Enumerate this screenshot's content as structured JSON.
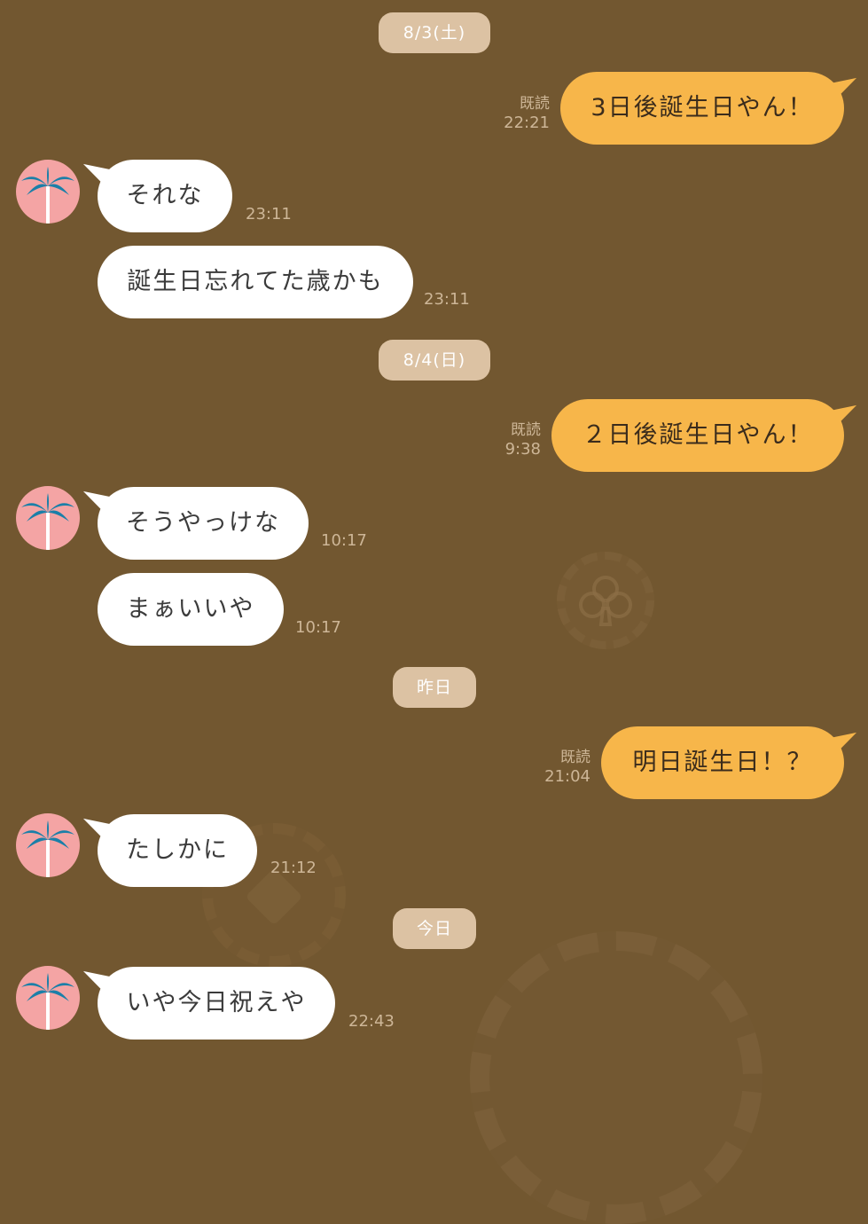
{
  "colors": {
    "background": "#725730",
    "date_pill": "#dcc2a3",
    "outgoing_bubble": "#f7b64a",
    "incoming_bubble": "#ffffff",
    "avatar_bg": "#f4a4a4",
    "palm": "#1b7fa8"
  },
  "avatar_icon": "palm-tree-icon",
  "read_label": "既読",
  "dates": {
    "d1": "8/3(土)",
    "d2": "8/4(日)",
    "d3": "昨日",
    "d4": "今日"
  },
  "messages": {
    "m1": {
      "text": "3日後誕生日やん！",
      "time": "22:21"
    },
    "m2": {
      "text": "それな",
      "time": "23:11"
    },
    "m3": {
      "text": "誕生日忘れてた歳かも",
      "time": "23:11"
    },
    "m4": {
      "text": "２日後誕生日やん！",
      "time": "9:38"
    },
    "m5": {
      "text": "そうやっけな",
      "time": "10:17"
    },
    "m6": {
      "text": "まぁいいや",
      "time": "10:17"
    },
    "m7": {
      "text": "明日誕生日！？",
      "time": "21:04"
    },
    "m8": {
      "text": "たしかに",
      "time": "21:12"
    },
    "m9": {
      "text": "いや今日祝えや",
      "time": "22:43"
    }
  }
}
